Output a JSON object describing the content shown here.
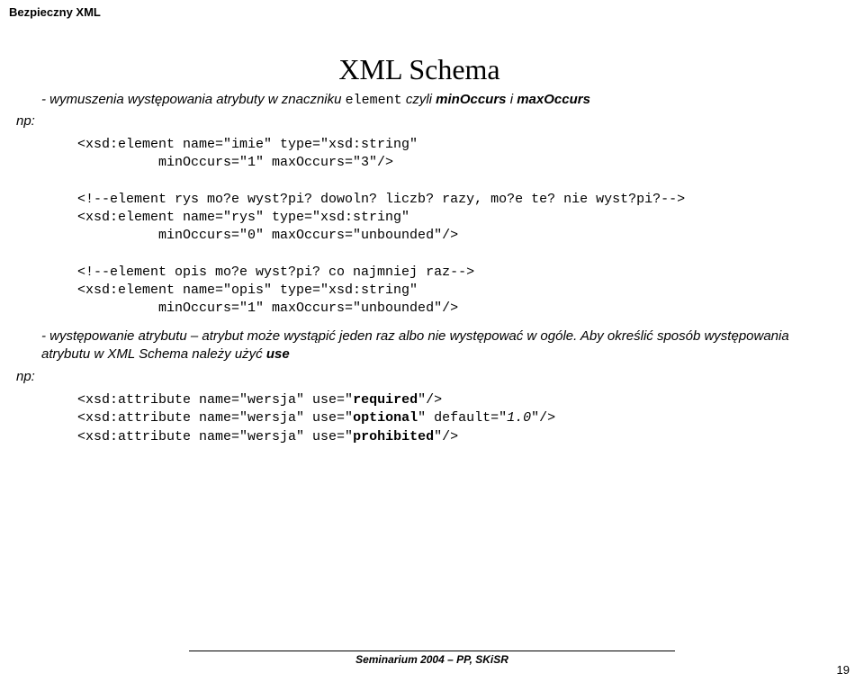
{
  "doc_header": "Bezpieczny XML",
  "title": "XML Schema",
  "bullet1_prefix": "- wymuszenia występowania atrybuty w znaczniku ",
  "bullet1_code": "element",
  "bullet1_mid": " czyli ",
  "bullet1_b1": "minOccurs",
  "bullet1_and": " i ",
  "bullet1_b2": "maxOccurs",
  "np": "np:",
  "code1_l1": "<xsd:element name=\"imie\" type=\"xsd:string\"",
  "code1_l2": "          minOccurs=\"1\" maxOccurs=\"3\"/>",
  "code1_l3": "",
  "code1_c1": "<!--element rys mo?e wyst?pi? dowoln? liczb? razy, mo?e te? nie wyst?pi?-->",
  "code1_l4": "<xsd:element name=\"rys\" type=\"xsd:string\"",
  "code1_l5": "          minOccurs=\"0\" maxOccurs=\"unbounded\"/>",
  "code1_l6": "",
  "code1_c2": "<!--element opis mo?e wyst?pi? co najmniej raz-->",
  "code1_l7": "<xsd:element name=\"opis\" type=\"xsd:string\"",
  "code1_l8": "          minOccurs=\"1\" maxOccurs=\"unbounded\"/>",
  "bullet2_a": "- występowanie atrybutu – atrybut może wystąpić jeden raz albo nie występować w ogóle.    Aby określić sposób występowania atrybutu w XML Schema należy użyć ",
  "bullet2_use": "use",
  "code2_p1": "<xsd:attribute name=\"wersja\" use=\"",
  "code2_b1": "required",
  "code2_s1": "\"/>",
  "code2_p2": "<xsd:attribute name=\"wersja\" use=\"",
  "code2_b2": "optional",
  "code2_m2": "\" default=\"",
  "code2_i2": "1.0",
  "code2_s2": "\"/>",
  "code2_p3": "<xsd:attribute name=\"wersja\" use=\"",
  "code2_b3": "prohibited",
  "code2_s3": "\"/>",
  "footer": "Seminarium 2004 – PP, SKiSR",
  "page_num": "19"
}
